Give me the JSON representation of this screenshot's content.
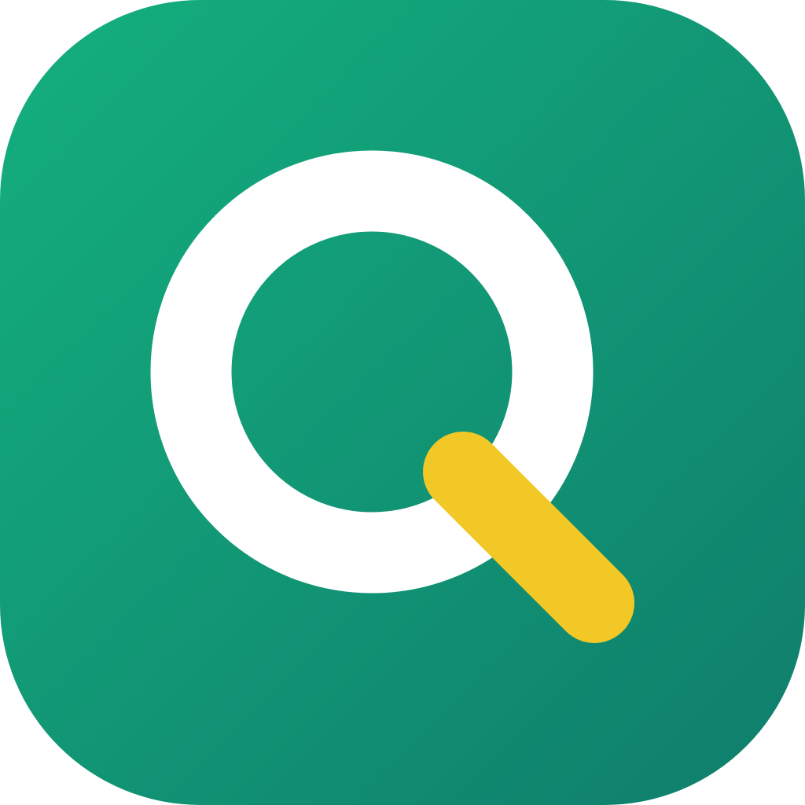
{
  "icon": {
    "name": "search-app-icon",
    "description_glyph": "magnifying-glass-icon",
    "colors": {
      "background_start": "#14b07e",
      "background_end": "#0f7d6c",
      "lens_ring": "#ffffff",
      "handle": "#f2c826"
    }
  }
}
